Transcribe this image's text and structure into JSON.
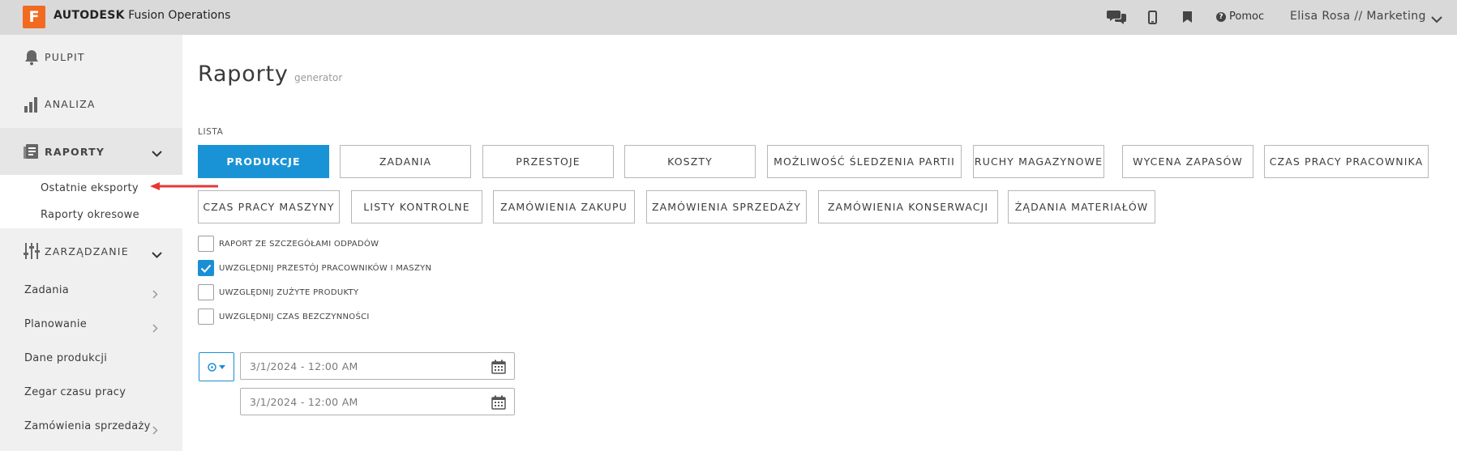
{
  "header": {
    "logo_letter": "F",
    "brand_bold": "AUTODESK",
    "brand_rest": " Fusion Operations",
    "help_label": "Pomoc",
    "user_label": "Elisa Rosa // Marketing",
    "colors": {
      "bar": "#d9d9d9",
      "logo": "#f26a21"
    }
  },
  "sidebar": {
    "pulpit": "PULPIT",
    "analiza": "ANALIZA",
    "raporty": "RAPORTY",
    "raporty_sub": [
      "Ostatnie eksporty",
      "Raporty okresowe"
    ],
    "zarzadzanie": "ZARZĄDZANIE",
    "items": [
      "Zadania",
      "Planowanie",
      "Dane produkcji",
      "Zegar czasu pracy",
      "Zamówienia sprzedaży"
    ]
  },
  "main": {
    "title": "Raporty",
    "subtitle": "generator",
    "list_label": "LISTA",
    "report_buttons": [
      "PRODUKCJE",
      "ZADANIA",
      "PRZESTOJE",
      "KOSZTY",
      "MOŻLIWOŚĆ ŚLEDZENIA PARTII",
      "RUCHY MAGAZYNOWE",
      "WYCENA ZAPASÓW",
      "CZAS PRACY PRACOWNIKA",
      "CZAS PRACY MASZYNY",
      "LISTY KONTROLNE",
      "ZAMÓWIENIA ZAKUPU",
      "ZAMÓWIENIA SPRZEDAŻY",
      "ZAMÓWIENIA KONSERWACJI",
      "ŻĄDANIA MATERIAŁÓW"
    ],
    "active_report": "PRODUKCJE",
    "options": [
      {
        "label": "RAPORT ZE SZCZEGÓŁAMI ODPADÓW",
        "checked": false
      },
      {
        "label": "UWZGLĘDNIJ PRZESTÓJ PRACOWNIKÓW I MASZYN",
        "checked": true
      },
      {
        "label": "UWZGLĘDNIJ ZUŻYTE PRODUKTY",
        "checked": false
      },
      {
        "label": "UWZGLĘDNIJ CZAS BEZCZYNNOŚCI",
        "checked": false
      }
    ],
    "date_from": "3/1/2024 - 12:00 AM",
    "date_to": "3/1/2024 - 12:00 AM",
    "accent_color": "#1a93d6"
  }
}
